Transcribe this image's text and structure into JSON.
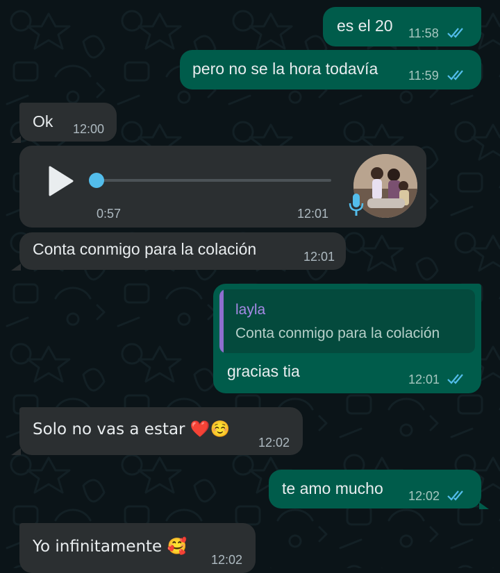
{
  "messages": [
    {
      "dir": "out",
      "text": "es el 20",
      "time": "11:58",
      "read": true
    },
    {
      "dir": "out",
      "text": "pero no se la hora todavía",
      "time": "11:59",
      "read": true
    },
    {
      "dir": "in",
      "text": "Ok",
      "time": "12:00"
    },
    {
      "dir": "in",
      "type": "voice",
      "duration": "0:57",
      "time": "12:01",
      "progress": 0
    },
    {
      "dir": "in",
      "text": "Conta conmigo para la colación",
      "time": "12:01"
    },
    {
      "dir": "out",
      "reply_to": {
        "author": "layla",
        "text": "Conta conmigo para la colación"
      },
      "text": "gracias tia",
      "time": "12:01",
      "read": true
    },
    {
      "dir": "in",
      "text": "Solo no vas a estar ❤️☺️",
      "time": "12:02"
    },
    {
      "dir": "out",
      "text": "te amo mucho",
      "time": "12:02",
      "read": true
    },
    {
      "dir": "in",
      "text": "Yo infinitamente 🥰",
      "time": "12:02"
    }
  ],
  "icons": {
    "read_ticks": "double-check-icon",
    "play": "play-icon",
    "mic": "microphone-icon",
    "avatar": "contact-avatar"
  },
  "colors": {
    "background": "#0b1418",
    "incoming_bubble": "#202c33",
    "outgoing_bubble": "#005c4b",
    "read_ticks": "#53bdeb",
    "voice_progress": "#53bdeb",
    "reply_bar": "#8e6ecf",
    "reply_author": "#a58ae6"
  }
}
